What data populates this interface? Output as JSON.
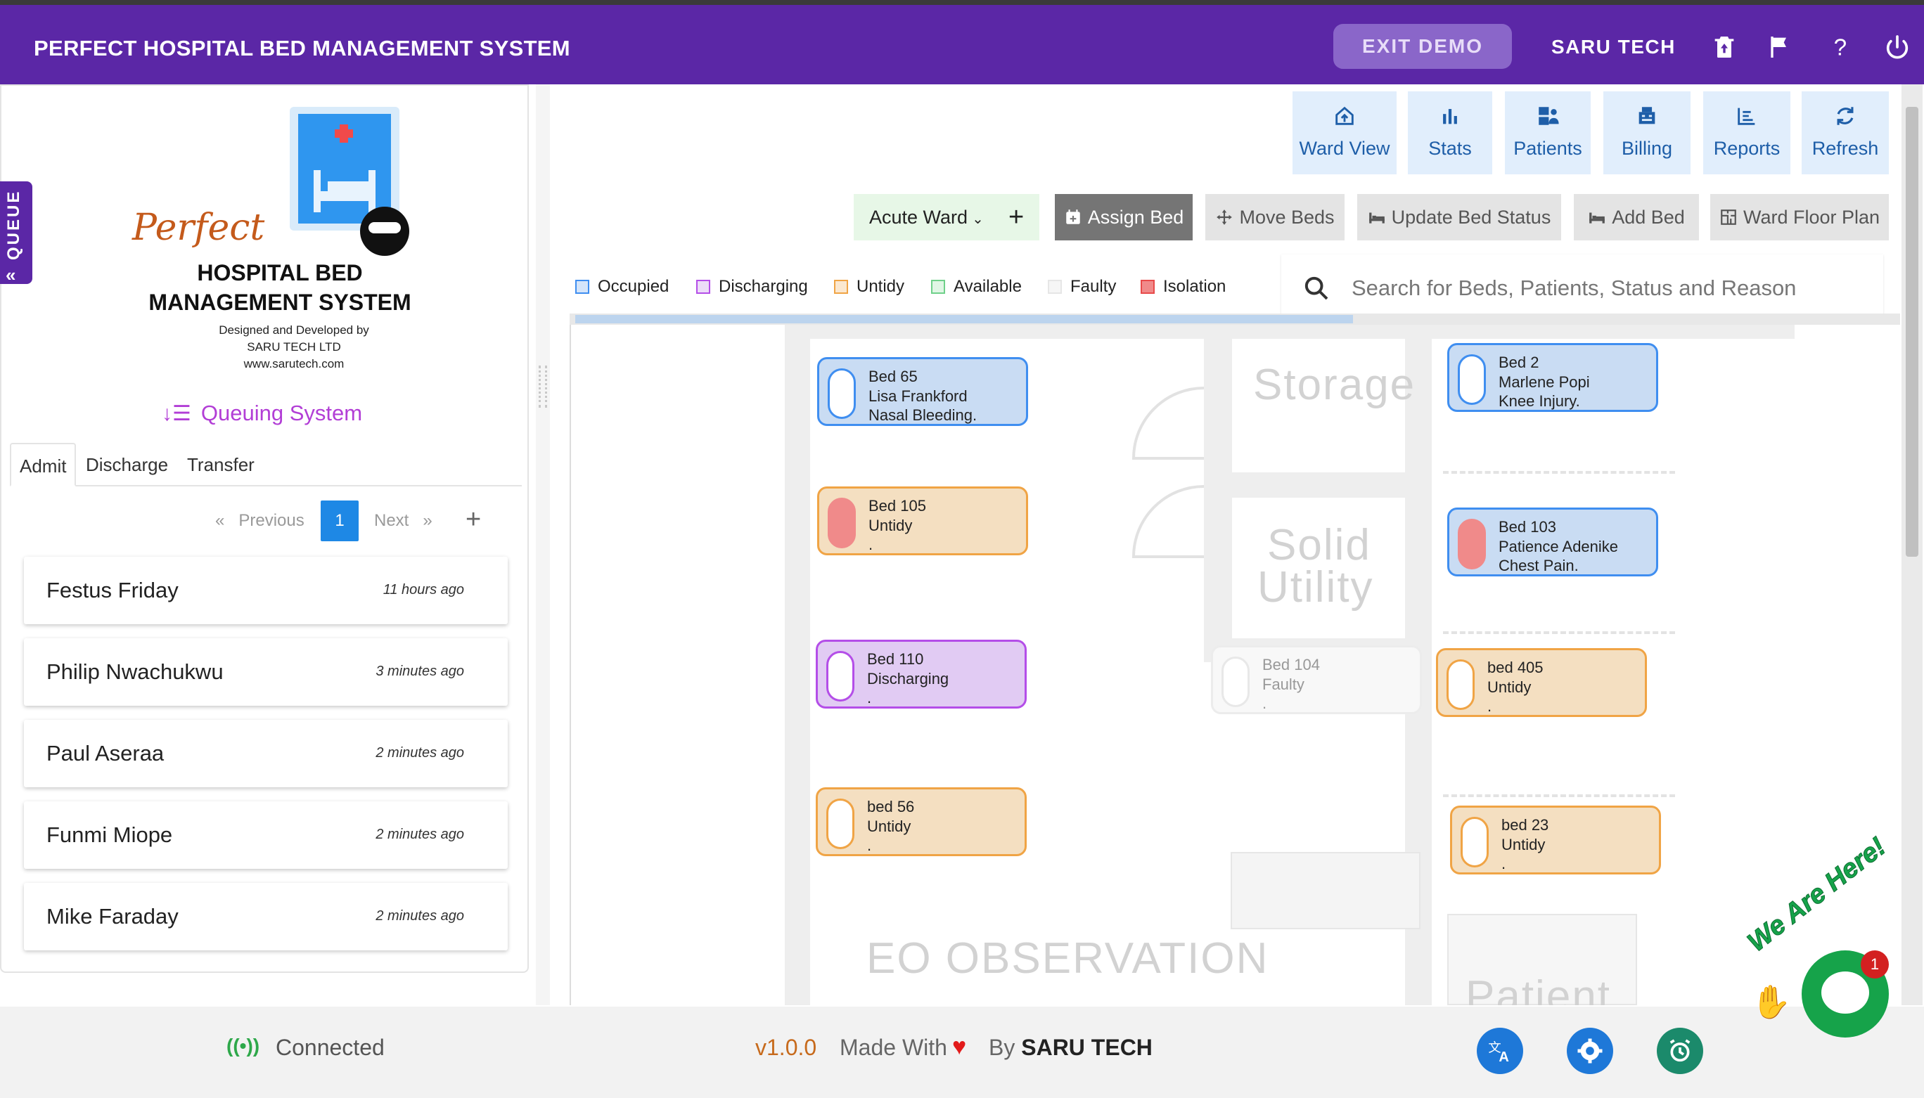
{
  "app": {
    "title": "PERFECT HOSPITAL BED MANAGEMENT SYSTEM",
    "exit_demo": "EXIT DEMO",
    "company_link": "SARU TECH",
    "header_icons": [
      "delete-icon",
      "flag-icon",
      "help-icon",
      "power-icon"
    ]
  },
  "sidebar": {
    "queue_tab": "QUEUE",
    "logo": {
      "perfect": "Perfect",
      "line1": "HOSPITAL BED",
      "line2": "MANAGEMENT SYSTEM",
      "designed": "Designed and Developed by",
      "company": "SARU TECH LTD",
      "website": "www.sarutech.com"
    },
    "queuing_title": "Queuing System",
    "tabs": [
      "Admit",
      "Discharge",
      "Transfer"
    ],
    "pager": {
      "previous": "Previous",
      "current": "1",
      "next": "Next",
      "prev_arrow": "«",
      "next_arrow": "»",
      "add": "+"
    },
    "queue": [
      {
        "name": "Festus Friday",
        "time": "11 hours ago"
      },
      {
        "name": "Philip Nwachukwu",
        "time": "3 minutes ago"
      },
      {
        "name": "Paul Aseraa",
        "time": "2 minutes ago"
      },
      {
        "name": "Funmi Miope",
        "time": "2 minutes ago"
      },
      {
        "name": "Mike Faraday",
        "time": "2 minutes ago"
      }
    ]
  },
  "nav": [
    "Ward View",
    "Stats",
    "Patients",
    "Billing",
    "Reports",
    "Refresh"
  ],
  "toolbar": {
    "ward": "Acute Ward",
    "ward_add": "+",
    "assign_bed": "Assign Bed",
    "move_beds": "Move Beds",
    "update_status": "Update Bed Status",
    "add_bed": "Add Bed",
    "floor_plan": "Ward Floor Plan"
  },
  "legend": [
    {
      "label": "Occupied",
      "color": "#3f8ef0"
    },
    {
      "label": "Discharging",
      "color": "#b44ee8"
    },
    {
      "label": "Untidy",
      "color": "#f0a445"
    },
    {
      "label": "Available",
      "color": "#6fd08a"
    },
    {
      "label": "Faulty",
      "color": "#e6e6e6"
    },
    {
      "label": "Isolation",
      "color": "#e84a4a"
    }
  ],
  "search": {
    "placeholder": "Search for Beds, Patients, Status and Reason"
  },
  "floor_labels": {
    "storage": "Storage",
    "solid1": "Solid",
    "solid2": "Utility",
    "eo": "EO OBSERVATION",
    "patient": "Patient"
  },
  "beds": [
    {
      "name": "Bed 65",
      "line2": "Lisa Frankford",
      "line3": "Nasal Bleeding.",
      "status": "occupied"
    },
    {
      "name": "Bed 2",
      "line2": "Marlene Popi",
      "line3": "Knee Injury.",
      "status": "occupied"
    },
    {
      "name": "Bed 105",
      "line2": "Untidy",
      "line3": ".",
      "status": "untidy-isolation"
    },
    {
      "name": "Bed 103",
      "line2": "Patience Adenike",
      "line3": "Chest Pain.",
      "status": "occupied-isolation"
    },
    {
      "name": "Bed 110",
      "line2": "Discharging",
      "line3": ".",
      "status": "discharging"
    },
    {
      "name": "Bed 104",
      "line2": "Faulty",
      "line3": ".",
      "status": "faulty"
    },
    {
      "name": "bed 405",
      "line2": "Untidy",
      "line3": ".",
      "status": "untidy"
    },
    {
      "name": "bed 56",
      "line2": "Untidy",
      "line3": ".",
      "status": "untidy"
    },
    {
      "name": "bed 23",
      "line2": "Untidy",
      "line3": ".",
      "status": "untidy"
    }
  ],
  "footer": {
    "status": "Connected",
    "version": "v1.0.0",
    "made_with": "Made With",
    "by": "By",
    "company": "SARU TECH",
    "chat_prompt": "We Are Here!",
    "chat_badge": "1"
  }
}
